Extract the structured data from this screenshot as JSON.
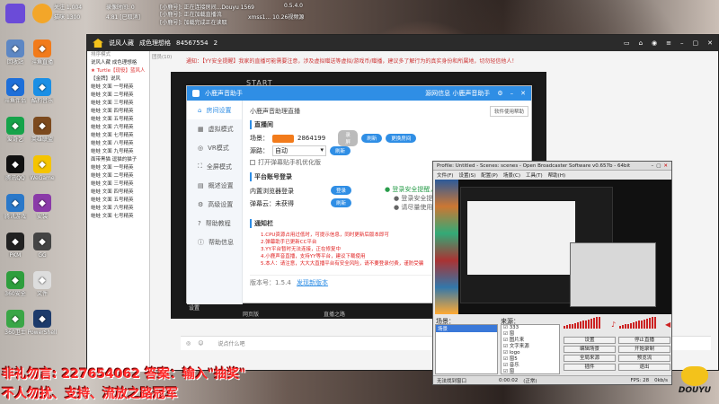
{
  "top_strip": {
    "items": [
      {
        "label": "关注 1,004"
      },
      {
        "label": "猫咪 1300"
      },
      {
        "label": "录像时间: 0"
      },
      {
        "label": "4.81  [已取消]"
      },
      {
        "label": "[小鹿号]: 正在连接房间...Douyu 1569"
      },
      {
        "label": "[小鹿号]: 正在加载直播流"
      },
      {
        "label": "[小鹿号]: 加载完成正在读取"
      },
      {
        "label": "xmss1... 10.26视频源"
      },
      {
        "label": "0.5.4.0"
      }
    ]
  },
  "desktop_icons": [
    {
      "label": "回收站",
      "icon": "recycle-bin-icon",
      "color": "#5d87c4"
    },
    {
      "label": "斗鱼直播",
      "icon": "fish-icon",
      "color": "#f27b1b"
    },
    {
      "label": "斗鱼伴侣",
      "icon": "fish-icon",
      "color": "#1e6fd9"
    },
    {
      "label": "酷狗音乐",
      "icon": "music-icon",
      "color": "#1b8fe5"
    },
    {
      "label": "爱奇艺",
      "icon": "iqiyi-icon",
      "color": "#16a34a"
    },
    {
      "label": "英雄联盟",
      "icon": "game-icon",
      "color": "#7c4a1e"
    },
    {
      "label": "腾讯QQ",
      "icon": "qq-icon",
      "color": "#111111"
    },
    {
      "label": "WeGame",
      "icon": "wegame-icon",
      "color": "#f5c400"
    },
    {
      "label": "腾讯游戏",
      "icon": "game-icon",
      "color": "#2a78c9"
    },
    {
      "label": "安装",
      "icon": "package-icon",
      "color": "#8a3aa8"
    },
    {
      "label": "PKM",
      "icon": "game-icon",
      "color": "#222222"
    },
    {
      "label": "GG",
      "icon": "game-icon",
      "color": "#444444"
    },
    {
      "label": "360安全",
      "icon": "shield-icon",
      "color": "#2e9e3d"
    },
    {
      "label": "文件",
      "icon": "document-icon",
      "color": "#dddddd"
    },
    {
      "label": "360卫士",
      "icon": "shield-icon",
      "color": "#3aa646"
    },
    {
      "label": "PowerShell",
      "icon": "terminal-icon",
      "color": "#1d3b6b"
    }
  ],
  "douyu_client": {
    "title_left": "说风人藏",
    "title_mid": "成色理想格",
    "room_id": "84567554",
    "follow_count": "2",
    "notice": "通知：【YY安全提醒】我家的直播可能需要注意，涉及虚拟赠送等虚拟/游戏币/赠播，建议多了解行为的真实身份和所属地，切勿轻信他人！",
    "sidebar_rows": [
      "说风人藏  成色理想格",
      "★ Turtle【现役】蓝风人",
      "【金牌】说风",
      "蛙蛙 文面 一号精英",
      "蛙蛙 文面 二号精英",
      "蛙蛙 文面 三号精英",
      "蛙蛙 文面 四号精英",
      "蛙蛙 文面 五号精英",
      "蛙蛙 文面 六号精英",
      "蛙蛙 文面 七号精英",
      "蛙蛙 文面 八号精英",
      "蛙蛙 文面 九号精英",
      "面带黑猫 逗猫的猫子",
      "蛙蛙 文面 一号精英",
      "蛙蛙 文面 二号精英",
      "蛙蛙 文面 三号精英",
      "蛙蛙 文面 四号精英",
      "蛙蛙 文面 五号精英",
      "蛙蛙 文面 六号精英",
      "蛙蛙 文面 七号精英"
    ],
    "section_mode": "排序模式",
    "list_head": "团员(10)",
    "bottom_input_placeholder": "说点什么吧",
    "bottom_tabs": [
      "网页版",
      "直播之路"
    ],
    "share_label": "分享"
  },
  "helper": {
    "title": "小鹿声音助手",
    "start_label": "START",
    "title_right": "源网信息  小鹿声音助手",
    "nav": [
      {
        "label": "房间设置",
        "icon": "home-icon"
      },
      {
        "label": "虚拟模式",
        "icon": "grid-icon"
      },
      {
        "label": "VR模式",
        "icon": "vr-icon"
      },
      {
        "label": "全屏模式",
        "icon": "fullscreen-icon"
      },
      {
        "label": "概述设置",
        "icon": "chart-icon"
      },
      {
        "label": "高级设置",
        "icon": "gear-icon"
      },
      {
        "label": "帮助教程",
        "icon": "help-icon"
      },
      {
        "label": "帮助信息",
        "icon": "info-icon"
      }
    ],
    "breadcrumb": "小鹿声音助理直播",
    "top_button": "软件使用帮助",
    "sec_live": "直播间",
    "room_label": "场景：",
    "room_id": "2864199",
    "btn_grey": "录屏",
    "btn_enter": "刷新",
    "btn_more": "更换房间",
    "source_label": "源路：",
    "source_value": "自动",
    "refresh_label": "刷新",
    "checkbox_label": "打开弹幕贴手机优化版",
    "sec_platform": "平台账号登录",
    "row1_label": "内置浏览器登录",
    "row1_btn": "登录",
    "row2_label": "弹幕云：未获得",
    "row2_btn": "刷新",
    "status1": "登录安全提醒，请使用",
    "status2": "登录安全提醒，请使用",
    "status3": "请尽量使用正版",
    "sec_notice": "通知栏",
    "tips": [
      "1.CPU资源占用过低时，可提示信息，同时更新后版本即可",
      "2.弹幕助手已更新CC平台",
      "3.YY平台暂时无法连接，正在修复中",
      "4.小鹿声音直播，支持YY等平台，建议下载使用",
      "5.本人：请注意，大大大直播平台有安全风险，请不要登录付费，谨防受骗"
    ],
    "version_label": "版本号：1.5.4",
    "version_link": "发现新版本",
    "footer_label": "设置"
  },
  "obs": {
    "title": "Profile: Untitled - Scenes: scenes - Open Broadcaster Software v0.657b - 64bit",
    "menu": [
      "文件(F)",
      "设置(S)",
      "配置(P)",
      "场景(C)",
      "工具(T)",
      "帮助(H)"
    ],
    "scenes_label": "场景：",
    "sources_label": "来源：",
    "scenes": [
      "场景"
    ],
    "sources": [
      {
        "label": "333",
        "checked": true
      },
      {
        "label": "窗",
        "checked": true
      },
      {
        "label": "图片来",
        "checked": true
      },
      {
        "label": "文字来源",
        "checked": true
      },
      {
        "label": "logo",
        "checked": true
      },
      {
        "label": "窗5",
        "checked": true
      },
      {
        "label": "音乐",
        "checked": true
      },
      {
        "label": "窗",
        "checked": true
      }
    ],
    "buttons_left": [
      "设置",
      "编辑场景",
      "全局来源",
      "插件"
    ],
    "buttons_right": [
      "停止直播",
      "开始录制",
      "预览流",
      "退出"
    ],
    "status": [
      "无法找到窗口",
      "0:00:02",
      "(正常)",
      "FPS: 28",
      "0kb/s"
    ]
  },
  "overlay": {
    "line1": "非礼勿言: 227654062 答案：输入\"抽奖\"",
    "line2": "不人勿扰、支持、流放之路冠军"
  },
  "logo": {
    "text": "DOUYU"
  }
}
